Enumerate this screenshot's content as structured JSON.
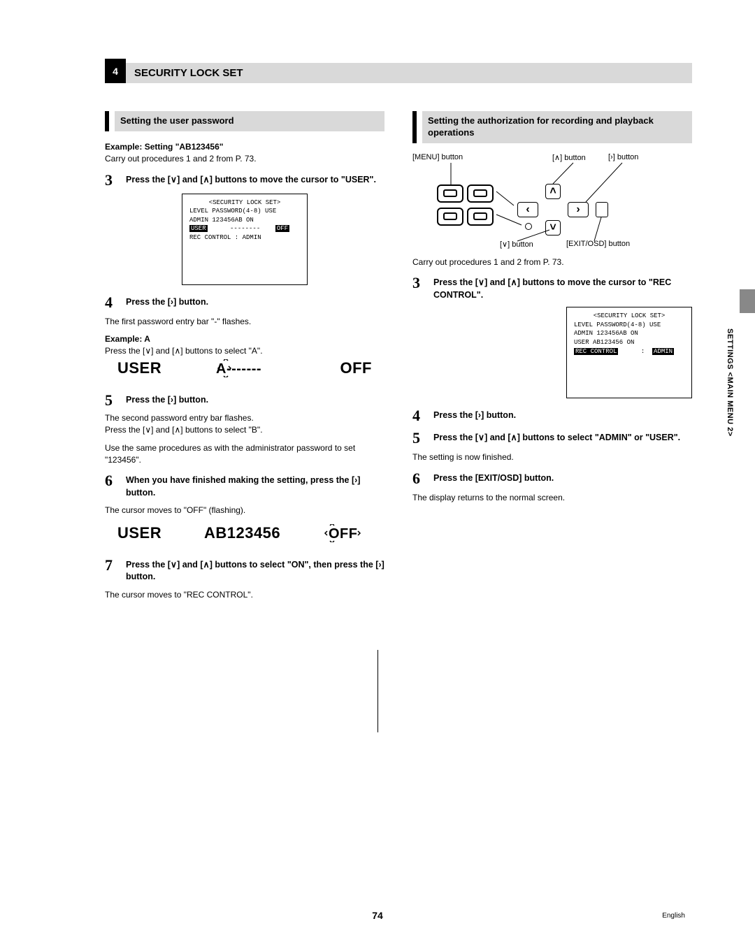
{
  "title": {
    "num": "4",
    "text": "SECURITY LOCK SET"
  },
  "sidebar": {
    "text": "SETTINGS <MAIN MENU 2>"
  },
  "page_number": "74",
  "lang": "English",
  "left": {
    "section_header": "Setting the user password",
    "example_label": "Example: Setting \"AB123456\"",
    "intro": "Carry out procedures 1 and 2 from P. 73.",
    "step3_num": "3",
    "step3_text": "Press the [∨] and [∧] buttons to move the cursor to \"USER\".",
    "osd1": {
      "title": "<SECURITY LOCK SET>",
      "r1": "LEVEL   PASSWORD(4-8)   USE",
      "r2": "ADMIN     123456AB     ON",
      "r3a": "USER",
      "r3b": "--------",
      "r3c": "OFF",
      "r4": "REC CONTROL       :   ADMIN"
    },
    "step4_num": "4",
    "step4_text": "Press the [›] button.",
    "step4_body": "The first password entry bar \"-\" flashes.",
    "exA_label": "Example: A",
    "exA_body": "Press the [∨] and [∧] buttons to select \"A\".",
    "disp1": {
      "a": "USER",
      "b": "A-------",
      "c": "OFF"
    },
    "step5_num": "5",
    "step5_text": "Press the [›] button.",
    "step5_body1": "The second password entry bar flashes.",
    "step5_body2": "Press the [∨] and [∧] buttons to select \"B\".",
    "step5_body3": "Use the same procedures as with the administrator password to set \"123456\".",
    "step6_num": "6",
    "step6_text": "When you have finished making the setting, press the [›] button.",
    "step6_body": "The cursor moves to \"OFF\" (flashing).",
    "disp2": {
      "a": "USER",
      "b": "AB123456",
      "c": "OFF"
    },
    "step7_num": "7",
    "step7_text": "Press the [∨] and [∧] buttons to select \"ON\", then press the [›] button.",
    "step7_body": "The cursor moves to \"REC CONTROL\"."
  },
  "right": {
    "section_header": "Setting the authorization for recording and playback operations",
    "labels": {
      "menu": "[MENU] button",
      "up": "[∧] button",
      "right": "[›] button",
      "down": "[∨] button",
      "exit": "[EXIT/OSD] button"
    },
    "intro": "Carry out procedures 1 and 2 from P. 73.",
    "step3_num": "3",
    "step3_text": "Press the [∨] and [∧] buttons to move the cursor to \"REC CONTROL\".",
    "osd2": {
      "title": "<SECURITY LOCK SET>",
      "r1": "LEVEL   PASSWORD(4-8)   USE",
      "r2": "ADMIN     123456AB     ON",
      "r3": "USER      AB123456     ON",
      "r4a": "REC CONTROL",
      "r4b": ":",
      "r4c": "ADMIN"
    },
    "step4_num": "4",
    "step4_text": "Press the [›] button.",
    "step5_num": "5",
    "step5_text": "Press the [∨] and [∧] buttons to select \"ADMIN\" or \"USER\".",
    "step5_body": "The setting is now finished.",
    "step6_num": "6",
    "step6_text": "Press the [EXIT/OSD] button.",
    "step6_body": "The display returns to the normal screen."
  }
}
